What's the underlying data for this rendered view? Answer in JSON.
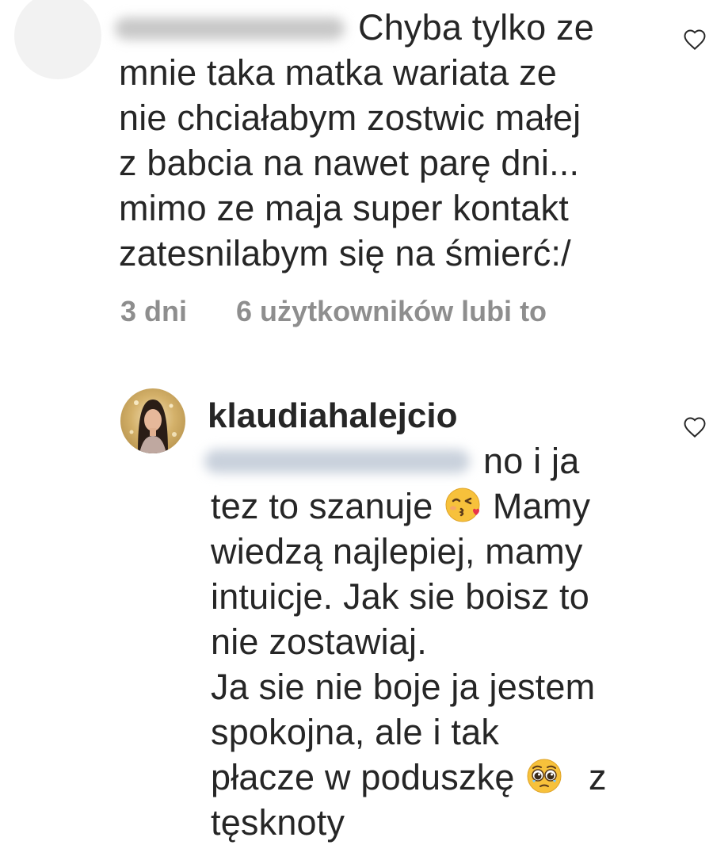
{
  "comment1": {
    "text_lines": [
      "Chyba tylko ze",
      "mnie taka matka wariata ze",
      "nie chciałabym zostwic małej",
      "z babcia na nawet parę dni...",
      "mimo ze maja super kontakt",
      "zatesnilabym się na śmierć:/"
    ],
    "time": "3 dni",
    "likes": "6 użytkowników lubi to",
    "heart_icon": "heart-outline-icon"
  },
  "comment2": {
    "username": "klaudiahalejcio",
    "first_line_text": "no i ja",
    "line2_before": "tez to szanuje",
    "line2_after": "Mamy",
    "lines_middle": [
      "wiedzą najlepiej, mamy",
      "intuicje. Jak sie boisz to",
      "nie zostawiaj.",
      "Ja sie nie boje ja jestem",
      "spokojna, ale i tak"
    ],
    "line_last_before": "płacze w poduszkę",
    "line_last_after": "z",
    "line_final": "tęsknoty",
    "emoji1": "kissing-face-emoji",
    "emoji2": "pleading-face-emoji",
    "heart_icon": "heart-outline-icon"
  },
  "colors": {
    "text": "#262626",
    "meta": "#8e8e8e",
    "blur": "#c9d1dc"
  }
}
